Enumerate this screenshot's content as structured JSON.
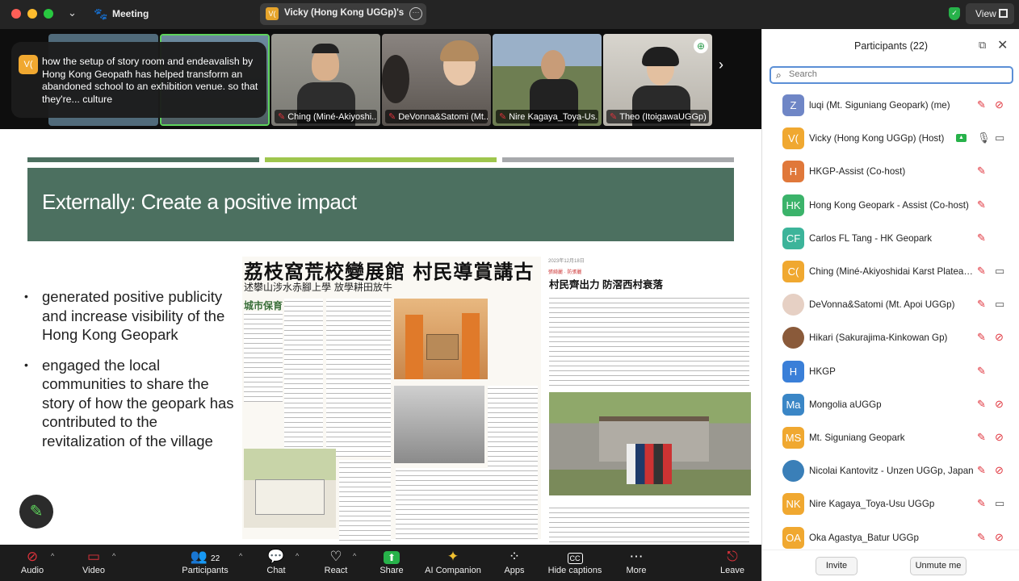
{
  "titlebar": {
    "title": "Meeting",
    "share_label": "Vicky (Hong Kong UGGp)'s sc",
    "share_initials": "V(",
    "view_label": "View"
  },
  "video": {
    "tiles": [
      {
        "name": "",
        "muted": true,
        "bg": "#506a7a"
      },
      {
        "name": "Ching (Miné-Akiyoshi...",
        "muted": true,
        "bg": "#8a8a84"
      },
      {
        "name": "DeVonna&Satomi (Mt...",
        "muted": true,
        "bg": "#6b6560"
      },
      {
        "name": "Nire Kagaya_Toya-Us...",
        "muted": true,
        "bg": "#6e7e52"
      },
      {
        "name": "Theo (ItoigawaUGGp)",
        "muted": true,
        "bg": "#c9c6bf"
      }
    ]
  },
  "caption": {
    "initials": "V(",
    "text": "how the setup of story room and endeavalish by Hong Kong Geopath has helped transform an abandoned school to an exhibition venue. so that they're... culture"
  },
  "slide": {
    "title": "Externally: Create a positive impact",
    "bands": [
      "#4c7060",
      "#9ec64d",
      "#a7a9ac"
    ],
    "bullets": [
      "generated positive publicity and increase visibility of the Hong Kong Geopark",
      "engaged the local communities to share the story of how the geopark has contributed to the revitalization of the village"
    ],
    "news_left": {
      "headline": "荔枝窩荒校變展館 村民導賞講古",
      "subhead": "述攀山涉水赤腳上學 放學耕田放牛",
      "logo": "城市保育"
    },
    "news_right": {
      "date": "2023年12月18日",
      "author": "張綺麗 · 防張麗",
      "headline": "村民齊出力 防滘西村衰落"
    }
  },
  "participants": {
    "title": "Participants (22)",
    "search_placeholder": "Search",
    "list": [
      {
        "initials": "Z",
        "color": "#6f86c6",
        "name": "luqi (Mt. Siguniang Geopark) (me)",
        "mic": "muted",
        "cam": "off"
      },
      {
        "initials": "V(",
        "color": "#f0a830",
        "name": "Vicky (Hong Kong UGGp) (Host)",
        "mic": "on",
        "cam": "on",
        "share": true
      },
      {
        "initials": "H",
        "color": "#e0783a",
        "name": "HKGP-Assist (Co-host)",
        "mic": "muted",
        "cam": ""
      },
      {
        "initials": "HK",
        "color": "#3bb36a",
        "name": "Hong Kong Geopark - Assist (Co-host)",
        "mic": "muted",
        "cam": ""
      },
      {
        "initials": "CF",
        "color": "#3cb49a",
        "name": "Carlos FL Tang - HK Geopark",
        "mic": "muted",
        "cam": ""
      },
      {
        "initials": "C(",
        "color": "#f0a830",
        "name": "Ching (Miné-Akiyoshidai Karst Plateau Geopark)",
        "mic": "muted",
        "cam": "on"
      },
      {
        "initials": "",
        "color": "#e6d0c4",
        "name": "DeVonna&Satomi (Mt. Apoi UGGp)",
        "mic": "muted",
        "cam": "on"
      },
      {
        "initials": "",
        "color": "#8a5a3a",
        "name": "Hikari (Sakurajima-Kinkowan Gp)",
        "mic": "muted",
        "cam": "off"
      },
      {
        "initials": "H",
        "color": "#3a7fd8",
        "name": "HKGP",
        "mic": "muted",
        "cam": ""
      },
      {
        "initials": "Ma",
        "color": "#3a86c6",
        "name": "Mongolia aUGGp",
        "mic": "muted",
        "cam": "off"
      },
      {
        "initials": "MS",
        "color": "#f0a830",
        "name": "Mt. Siguniang Geopark",
        "mic": "muted",
        "cam": "off"
      },
      {
        "initials": "",
        "color": "#3a7fb8",
        "name": "Nicolai Kantovitz - Unzen UGGp, Japan",
        "mic": "muted",
        "cam": "off"
      },
      {
        "initials": "NK",
        "color": "#f0a830",
        "name": "Nire Kagaya_Toya-Usu UGGp",
        "mic": "muted",
        "cam": "on"
      },
      {
        "initials": "OA",
        "color": "#f0a830",
        "name": "Oka Agastya_Batur UGGp",
        "mic": "muted",
        "cam": "off"
      }
    ],
    "invite_label": "Invite",
    "unmute_label": "Unmute me"
  },
  "toolbar": {
    "audio": "Audio",
    "video": "Video",
    "participants": "Participants",
    "participant_count": "22",
    "chat": "Chat",
    "react": "React",
    "share": "Share",
    "ai": "AI Companion",
    "apps": "Apps",
    "captions": "Hide captions",
    "more": "More",
    "leave": "Leave"
  }
}
